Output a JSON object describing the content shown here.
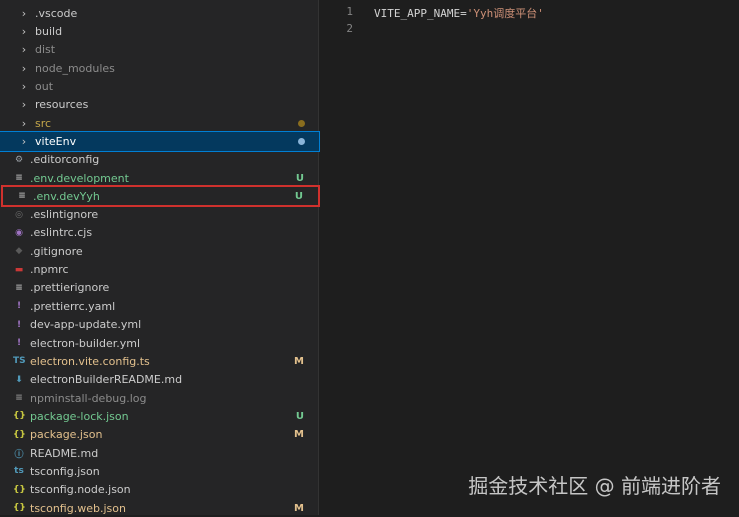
{
  "explorer": {
    "items": [
      {
        "label": ".vscode",
        "type": "folder",
        "color": "#cccccc"
      },
      {
        "label": "build",
        "type": "folder",
        "color": "#cccccc"
      },
      {
        "label": "dist",
        "type": "folder",
        "color": "#8c8c8c"
      },
      {
        "label": "node_modules",
        "type": "folder",
        "color": "#8c8c8c"
      },
      {
        "label": "out",
        "type": "folder",
        "color": "#8c8c8c"
      },
      {
        "label": "resources",
        "type": "folder",
        "color": "#cccccc"
      },
      {
        "label": "src",
        "type": "folder",
        "color": "#c4a64a",
        "dot": "#8a6d1e"
      },
      {
        "label": "viteEnv",
        "type": "folder",
        "color": "#ffffff",
        "dot": "#8ab4d8",
        "selected": true
      },
      {
        "label": ".editorconfig",
        "icon": "gear-icon",
        "glyph": "⚙",
        "iconColor": "#9aa0a6",
        "color": "#cccccc"
      },
      {
        "label": ".env.development",
        "icon": "file-lines-icon",
        "glyph": "≡",
        "iconColor": "#b0b0b0",
        "color": "#73c991",
        "decoration": "U"
      },
      {
        "label": ".env.devYyh",
        "icon": "file-lines-icon",
        "glyph": "≡",
        "iconColor": "#b0b0b0",
        "color": "#73c991",
        "decoration": "U",
        "highlighted": true
      },
      {
        "label": ".eslintignore",
        "icon": "eslint-icon",
        "glyph": "◎",
        "iconColor": "#6e6e6e",
        "color": "#cccccc"
      },
      {
        "label": ".eslintrc.cjs",
        "icon": "eslint-icon",
        "glyph": "◉",
        "iconColor": "#a074c4",
        "color": "#cccccc"
      },
      {
        "label": ".gitignore",
        "icon": "git-icon",
        "glyph": "◆",
        "iconColor": "#5a5a5a",
        "color": "#cccccc"
      },
      {
        "label": ".npmrc",
        "icon": "npm-icon",
        "glyph": "▬",
        "iconColor": "#cb3837",
        "color": "#cccccc"
      },
      {
        "label": ".prettierignore",
        "icon": "file-lines-icon",
        "glyph": "≡",
        "iconColor": "#b0b0b0",
        "color": "#cccccc"
      },
      {
        "label": ".prettierrc.yaml",
        "icon": "yaml-icon",
        "glyph": "!",
        "iconColor": "#a074c4",
        "color": "#cccccc"
      },
      {
        "label": "dev-app-update.yml",
        "icon": "yaml-icon",
        "glyph": "!",
        "iconColor": "#a074c4",
        "color": "#cccccc"
      },
      {
        "label": "electron-builder.yml",
        "icon": "yaml-icon",
        "glyph": "!",
        "iconColor": "#a074c4",
        "color": "#cccccc"
      },
      {
        "label": "electron.vite.config.ts",
        "icon": "typescript-icon",
        "glyph": "TS",
        "iconColor": "#519aba",
        "color": "#e2c08d",
        "decoration": "M"
      },
      {
        "label": "electronBuilderREADME.md",
        "icon": "markdown-icon",
        "glyph": "⬇",
        "iconColor": "#519aba",
        "color": "#cccccc"
      },
      {
        "label": "npminstall-debug.log",
        "icon": "file-lines-icon",
        "glyph": "≡",
        "iconColor": "#8c8c8c",
        "color": "#8c8c8c"
      },
      {
        "label": "package-lock.json",
        "icon": "json-icon",
        "glyph": "{}",
        "iconColor": "#cbcb41",
        "color": "#73c991",
        "decoration": "U"
      },
      {
        "label": "package.json",
        "icon": "json-icon",
        "glyph": "{}",
        "iconColor": "#cbcb41",
        "color": "#e2c08d",
        "decoration": "M"
      },
      {
        "label": "README.md",
        "icon": "info-icon",
        "glyph": "ⓘ",
        "iconColor": "#519aba",
        "color": "#cccccc"
      },
      {
        "label": "tsconfig.json",
        "icon": "tsconfig-icon",
        "glyph": "ts",
        "iconColor": "#519aba",
        "color": "#cccccc"
      },
      {
        "label": "tsconfig.node.json",
        "icon": "json-icon",
        "glyph": "{}",
        "iconColor": "#cbcb41",
        "color": "#cccccc"
      },
      {
        "label": "tsconfig.web.json",
        "icon": "json-icon",
        "glyph": "{}",
        "iconColor": "#cbcb41",
        "color": "#e2c08d",
        "decoration": "M"
      }
    ]
  },
  "editor": {
    "lines": [
      {
        "number": "1",
        "key": "VITE_APP_NAME=",
        "value": "'Yyh调度平台'"
      },
      {
        "number": "2",
        "key": "",
        "value": ""
      }
    ]
  },
  "watermark": "掘金技术社区 @ 前端进阶者"
}
